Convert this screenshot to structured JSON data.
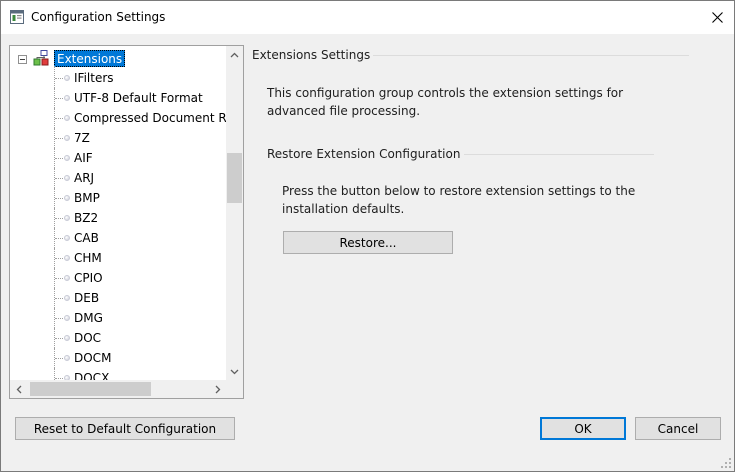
{
  "window": {
    "title": "Configuration Settings",
    "close_icon": "close-icon"
  },
  "tree": {
    "root_label": "Extensions",
    "items": [
      {
        "label": "IFilters"
      },
      {
        "label": "UTF-8 Default Format"
      },
      {
        "label": "Compressed Document R"
      },
      {
        "label": "7Z"
      },
      {
        "label": "AIF"
      },
      {
        "label": "ARJ"
      },
      {
        "label": "BMP"
      },
      {
        "label": "BZ2"
      },
      {
        "label": "CAB"
      },
      {
        "label": "CHM"
      },
      {
        "label": "CPIO"
      },
      {
        "label": "DEB"
      },
      {
        "label": "DMG"
      },
      {
        "label": "DOC"
      },
      {
        "label": "DOCM"
      },
      {
        "label": "DOCX"
      }
    ]
  },
  "settings": {
    "header": "Extensions Settings",
    "description": "This configuration group controls the extension settings for advanced file processing.",
    "restore_group": {
      "header": "Restore Extension Configuration",
      "description": "Press the button below to restore extension settings to the installation defaults.",
      "button_label": "Restore..."
    }
  },
  "footer": {
    "reset_label": "Reset to Default Configuration",
    "ok_label": "OK",
    "cancel_label": "Cancel"
  },
  "colors": {
    "selection": "#0078d7",
    "window_bg": "#f0f0f0",
    "button_bg": "#e1e1e1"
  }
}
